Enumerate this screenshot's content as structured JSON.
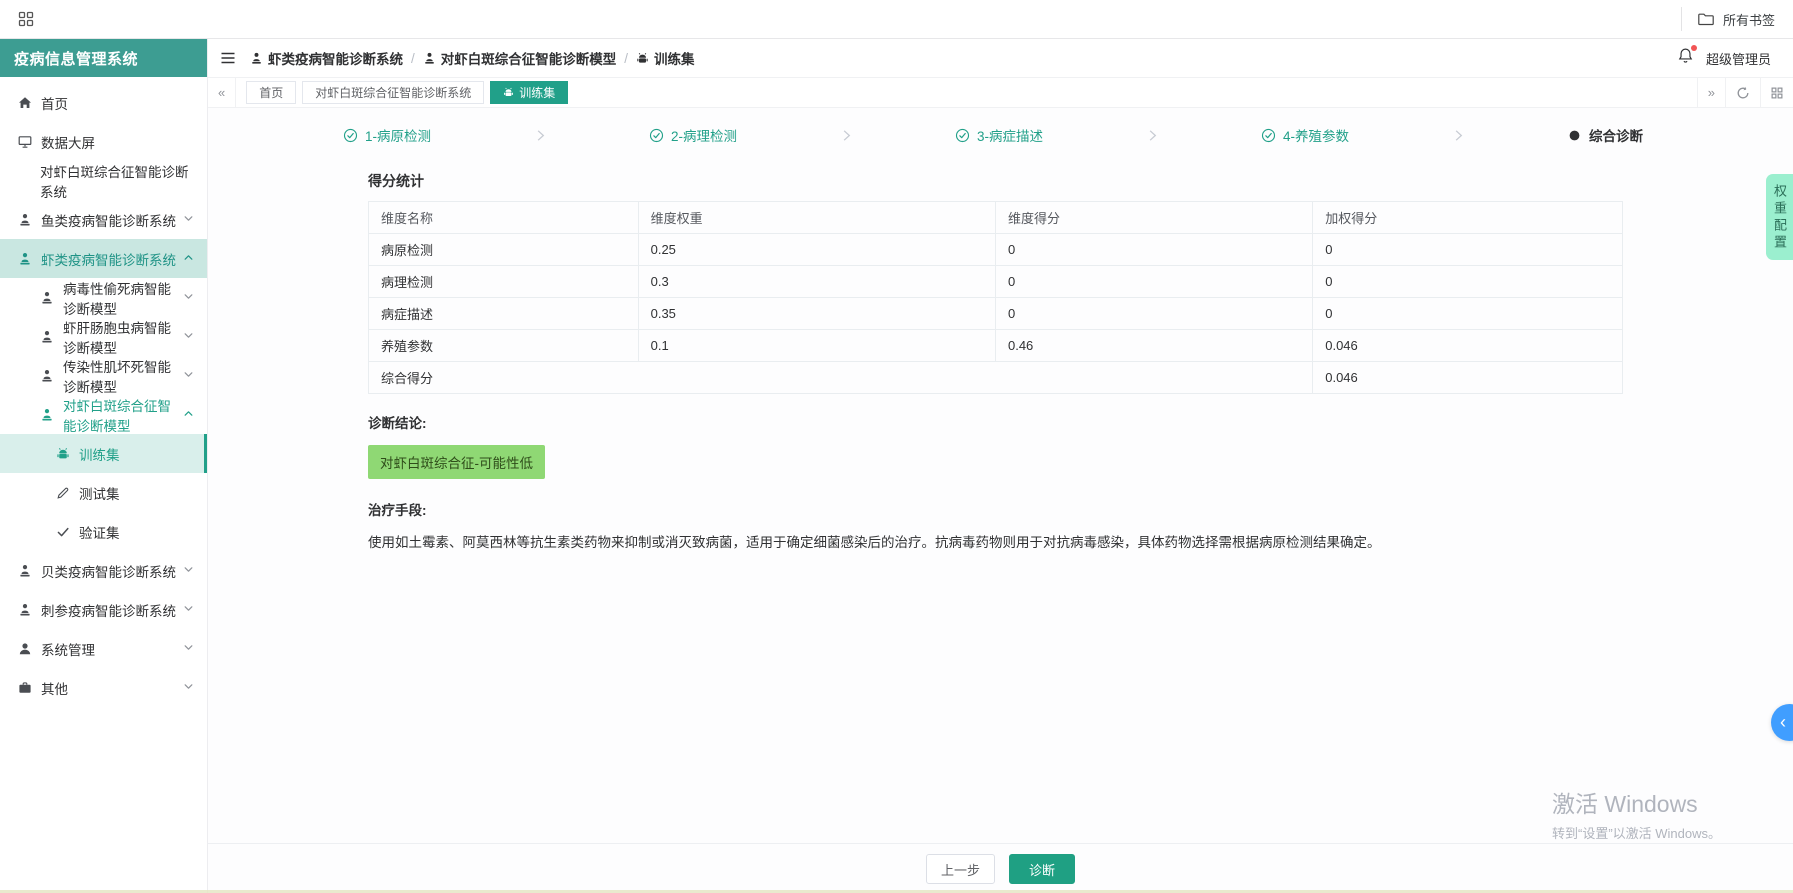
{
  "colors": {
    "accent_teal": "#21A089",
    "sidebar_header_bg": "#3D9D92",
    "badge_bg": "#8FD874",
    "badge_text": "#2F4D1A",
    "weight_tab_bg": "#9BEFCF",
    "panel_toggle_blue": "#409EFF"
  },
  "browser": {
    "bookmarks_label": "所有书签"
  },
  "sidebar": {
    "title": "疫病信息管理系统",
    "items": [
      {
        "id": "home",
        "label": "首页",
        "icon": "home",
        "level": 1,
        "chevron": null,
        "state": null
      },
      {
        "id": "data-screen",
        "label": "数据大屏",
        "icon": "screen",
        "level": 1,
        "chevron": null,
        "state": null
      },
      {
        "id": "wssv-system",
        "label": "对虾白斑综合征智能诊断系统",
        "icon": null,
        "level": 2,
        "chevron": null,
        "state": null
      },
      {
        "id": "fish-system",
        "label": "鱼类疫病智能诊断系统",
        "icon": "model",
        "level": 1,
        "chevron": "down",
        "state": null
      },
      {
        "id": "shrimp-system",
        "label": "虾类疫病智能诊断系统",
        "icon": "model",
        "level": 1,
        "chevron": "up",
        "state": "parent-open"
      },
      {
        "id": "viral-covert-model",
        "label": "病毒性偷死病智能诊断模型",
        "icon": "model",
        "level": 2,
        "chevron": "down",
        "state": null
      },
      {
        "id": "ehp-model",
        "label": "虾肝肠胞虫病智能诊断模型",
        "icon": "model",
        "level": 2,
        "chevron": "down",
        "state": null
      },
      {
        "id": "imn-model",
        "label": "传染性肌坏死智能诊断模型",
        "icon": "model",
        "level": 2,
        "chevron": "down",
        "state": null
      },
      {
        "id": "wssv-model",
        "label": "对虾白斑综合征智能诊断模型",
        "icon": "model",
        "level": 2,
        "chevron": "up",
        "state": "active-text"
      },
      {
        "id": "training-set",
        "label": "训练集",
        "icon": "robot",
        "level": 3,
        "chevron": null,
        "state": "selected"
      },
      {
        "id": "test-set",
        "label": "测试集",
        "icon": "pencil",
        "level": 3,
        "chevron": null,
        "state": null
      },
      {
        "id": "verify-set",
        "label": "验证集",
        "icon": "check",
        "level": 3,
        "chevron": null,
        "state": null
      },
      {
        "id": "shellfish-system",
        "label": "贝类疫病智能诊断系统",
        "icon": "model",
        "level": 1,
        "chevron": "down",
        "state": null
      },
      {
        "id": "seacucumber-system",
        "label": "刺参疫病智能诊断系统",
        "icon": "model",
        "level": 1,
        "chevron": "down",
        "state": null
      },
      {
        "id": "system-admin",
        "label": "系统管理",
        "icon": "user",
        "level": 1,
        "chevron": "down",
        "state": null
      },
      {
        "id": "other",
        "label": "其他",
        "icon": "briefcase",
        "level": 1,
        "chevron": "down",
        "state": null
      }
    ]
  },
  "header": {
    "breadcrumb": [
      {
        "label": "虾类疫病智能诊断系统",
        "icon": "model"
      },
      {
        "label": "对虾白斑综合征智能诊断模型",
        "icon": "model"
      },
      {
        "label": "训练集",
        "icon": "robot"
      }
    ],
    "user": "超级管理员"
  },
  "tabbar": {
    "tabs": [
      {
        "label": "首页",
        "icon": null,
        "active": false
      },
      {
        "label": "对虾白斑综合征智能诊断系统",
        "icon": null,
        "active": false
      },
      {
        "label": "训练集",
        "icon": "robot",
        "active": true
      }
    ]
  },
  "steps": [
    {
      "label": "1-病原检测",
      "state": "done"
    },
    {
      "label": "2-病理检测",
      "state": "done"
    },
    {
      "label": "3-病症描述",
      "state": "done"
    },
    {
      "label": "4-养殖参数",
      "state": "done"
    },
    {
      "label": "综合诊断",
      "state": "current"
    }
  ],
  "score": {
    "title": "得分统计",
    "headers": [
      "维度名称",
      "维度权重",
      "维度得分",
      "加权得分"
    ],
    "rows": [
      [
        "病原检测",
        "0.25",
        "0",
        "0"
      ],
      [
        "病理检测",
        "0.3",
        "0",
        "0"
      ],
      [
        "病症描述",
        "0.35",
        "0",
        "0"
      ],
      [
        "养殖参数",
        "0.1",
        "0.46",
        "0.046"
      ]
    ],
    "total_label": "综合得分",
    "total_value": "0.046"
  },
  "diagnosis": {
    "label": "诊断结论:",
    "result": "对虾白斑综合征-可能性低"
  },
  "treatment": {
    "label": "治疗手段:",
    "text": "使用如土霉素、阿莫西林等抗生素类药物来抑制或消灭致病菌，适用于确定细菌感染后的治疗。抗病毒药物则用于对抗病毒感染，具体药物选择需根据病原检测结果确定。"
  },
  "footer": {
    "prev_label": "上一步",
    "diagnose_label": "诊断"
  },
  "weight_tab": {
    "label": "权重配置"
  },
  "watermark": {
    "line1": "激活 Windows",
    "line2": "转到“设置”以激活 Windows。"
  }
}
